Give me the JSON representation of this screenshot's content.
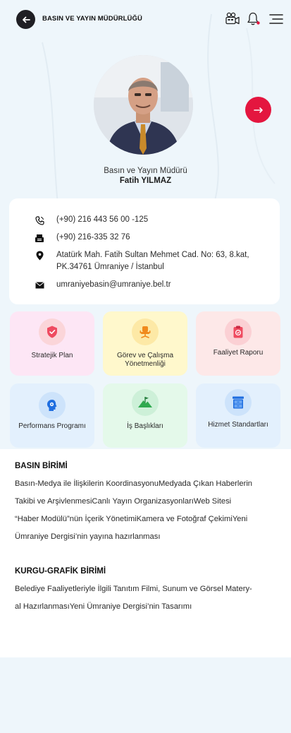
{
  "header": {
    "title": "BASIN VE YAYIN MÜDÜRLÜĞÜ",
    "icons": [
      "back-arrow-icon",
      "video-camera-icon",
      "bell-icon",
      "menu-icon"
    ]
  },
  "profile": {
    "role": "Basın ve Yayın Müdürü",
    "name": "Fatih YILMAZ"
  },
  "contact": {
    "phone": "(+90) 216 443 56 00 -125",
    "fax": "(+90) 216-335 32 76",
    "address_line1": "Atatürk Mah. Fatih Sultan Mehmet Cad. No: 63, 8.kat,",
    "address_line2": "PK.34761 Ümraniye / İstanbul",
    "email": "umraniyebasin@umraniye.bel.tr"
  },
  "tiles": [
    {
      "label": "Stratejik Plan",
      "icon": "shield-icon",
      "bg": "#fde6f5",
      "icon_bg": "#fbd5d9"
    },
    {
      "label": "Görev ve Çalışma Yönetmenliği",
      "icon": "office-chair-icon",
      "bg": "#fff8cc",
      "icon_bg": "#fde9a6"
    },
    {
      "label": "Faaliyet Raporu",
      "icon": "clipboard-icon",
      "bg": "#fde8e8",
      "icon_bg": "#fbd0d4"
    },
    {
      "label": "Performans Programı",
      "icon": "gear-head-icon",
      "bg": "#e3f0fd",
      "icon_bg": "#cde3fb"
    },
    {
      "label": "İş Başlıkları",
      "icon": "mountain-flag-icon",
      "bg": "#e4f9ea",
      "icon_bg": "#cdf0d8"
    },
    {
      "label": "Hizmet Standartları",
      "icon": "cabinet-icon",
      "bg": "#e3f0fd",
      "icon_bg": "#cde3fb"
    }
  ],
  "sections": [
    {
      "title": "BASIN BİRİMİ",
      "lines": [
        "Basın-Medya ile İlişkilerin KoordinasyonuMedyada Çıkan Haberlerin",
        "Takibi ve ArşivlenmesiCanlı Yayın OrganizasyonlarıWeb Sitesi",
        "“Haber Modülü”nün İçerik YönetimiKamera ve Fotoğraf ÇekimiYeni",
        "Ümraniye Dergisi’nin yayına hazırlanması"
      ]
    },
    {
      "title": "KURGU-GRAFİK BİRİMİ",
      "lines": [
        "Belediye Faaliyetleriyle İlgili Tanıtım Filmi, Sunum ve Görsel Matery-",
        "al HazırlanmasıYeni Ümraniye Dergisi’nin Tasarımı"
      ]
    }
  ],
  "colors": {
    "accent_red": "#e4163f",
    "page_bg": "#eef6fb",
    "dark": "#1f1f24"
  }
}
